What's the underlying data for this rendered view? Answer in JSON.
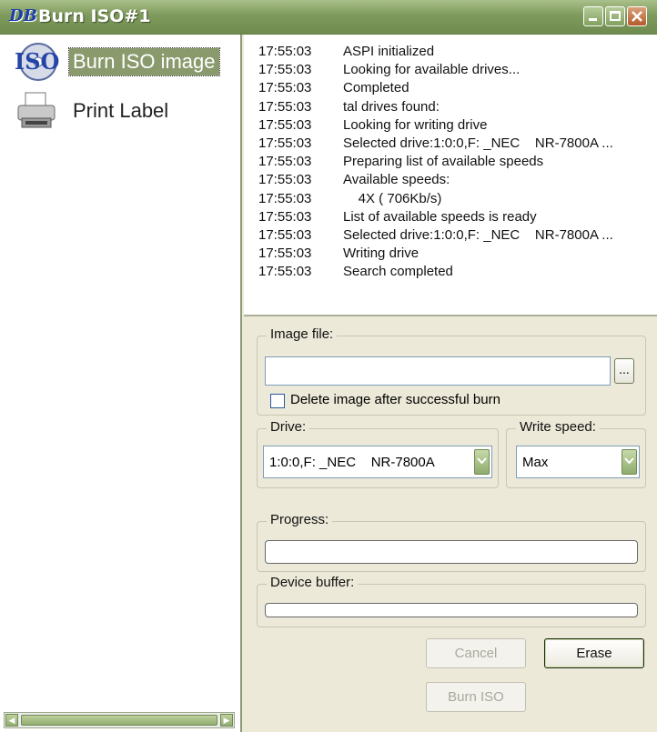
{
  "window": {
    "title": "Burn ISO#1",
    "app_icon_text": "DB"
  },
  "sidebar": {
    "items": [
      {
        "label": "Burn ISO image",
        "icon": "iso-disc-icon",
        "selected": true
      },
      {
        "label": "Print Label",
        "icon": "printer-icon",
        "selected": false
      }
    ]
  },
  "log": {
    "entries": [
      {
        "time": "17:55:03",
        "message": "ASPI initialized"
      },
      {
        "time": "17:55:03",
        "message": "Looking for available drives..."
      },
      {
        "time": "17:55:03",
        "message": "Completed"
      },
      {
        "time": "17:55:03",
        "message": "tal drives found:"
      },
      {
        "time": "17:55:03",
        "message": "Looking for writing drive"
      },
      {
        "time": "17:55:03",
        "message": "Selected drive:1:0:0,F: _NEC    NR-7800A ..."
      },
      {
        "time": "17:55:03",
        "message": "Preparing list of available speeds"
      },
      {
        "time": "17:55:03",
        "message": "Available speeds:"
      },
      {
        "time": "17:55:03",
        "message": "    4X ( 706Kb/s)"
      },
      {
        "time": "17:55:03",
        "message": "List of available speeds is ready"
      },
      {
        "time": "17:55:03",
        "message": "Selected drive:1:0:0,F: _NEC    NR-7800A ..."
      },
      {
        "time": "17:55:03",
        "message": "Writing drive"
      },
      {
        "time": "17:55:03",
        "message": "Search completed"
      }
    ]
  },
  "image_file": {
    "legend": "Image file:",
    "value": "",
    "browse_label": "...",
    "delete_checkbox_label": "Delete image after successful burn",
    "delete_checked": false
  },
  "drive": {
    "legend": "Drive:",
    "selected": "1:0:0,F: _NEC    NR-7800A"
  },
  "write_speed": {
    "legend": "Write speed:",
    "selected": "Max"
  },
  "progress": {
    "legend": "Progress:",
    "value_percent": 0
  },
  "device_buffer": {
    "legend": "Device buffer:",
    "value_percent": 0
  },
  "buttons": {
    "cancel": "Cancel",
    "erase": "Erase",
    "burn": "Burn ISO"
  },
  "colors": {
    "titlebar": "#7e9a5c",
    "selection": "#8a9a6d",
    "dialog_bg": "#ece9d8"
  }
}
